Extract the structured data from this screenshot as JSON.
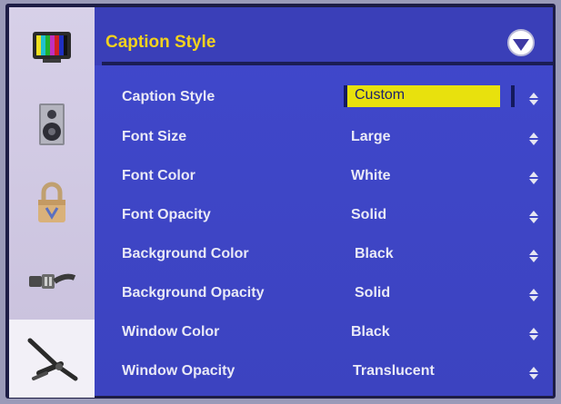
{
  "header": {
    "title": "Caption Style"
  },
  "sidebar": {
    "items": [
      {
        "icon": "tv-icon",
        "selected": false
      },
      {
        "icon": "speaker-icon",
        "selected": false
      },
      {
        "icon": "lock-icon",
        "selected": false
      },
      {
        "icon": "connector-cable-icon",
        "selected": false
      },
      {
        "icon": "tools-icon",
        "selected": true
      }
    ]
  },
  "settings": {
    "rows": [
      {
        "label": "Caption Style",
        "value": "Custom",
        "highlighted": true
      },
      {
        "label": "Font Size",
        "value": "Large"
      },
      {
        "label": "Font Color",
        "value": "White"
      },
      {
        "label": "Font Opacity",
        "value": "Solid"
      },
      {
        "label": "Background Color",
        "value": "Black"
      },
      {
        "label": "Background Opacity",
        "value": "Solid"
      },
      {
        "label": "Window Color",
        "value": "Black"
      },
      {
        "label": "Window Opacity",
        "value": "Translucent"
      }
    ]
  },
  "colors": {
    "title": "#f2d21e",
    "panel": "#3f46c8",
    "highlight": "#e8e10d"
  }
}
